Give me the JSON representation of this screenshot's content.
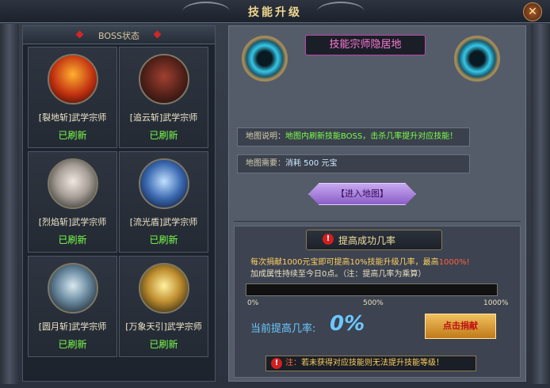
{
  "window": {
    "title": "技能升级",
    "close_glyph": "✕"
  },
  "boss_panel": {
    "header": "BOSS状态",
    "bosses": [
      {
        "name": "[裂地斩]武学宗师",
        "status": "已刷新"
      },
      {
        "name": "[追云斩]武学宗师",
        "status": "已刷新"
      },
      {
        "name": "[烈焰斩]武学宗师",
        "status": "已刷新"
      },
      {
        "name": "[流光盾]武学宗师",
        "status": "已刷新"
      },
      {
        "name": "[圆月斩]武学宗师",
        "status": "已刷新"
      },
      {
        "name": "[万象天引]武学宗师",
        "status": "已刷新"
      }
    ]
  },
  "map": {
    "title": "技能宗师隐居地",
    "desc_label": "地图说明：",
    "desc_value": "地图内刷新技能BOSS，击杀几率提升对应技能！",
    "need_label": "地图需要：",
    "need_value": "消耗 500 元宝",
    "enter_button": "【进入地图】"
  },
  "success": {
    "header": "提高成功几率",
    "warn_glyph": "!",
    "line1_a": "每次捐献1000元宝即可提高10%技能升级几率，最高",
    "line1_b": "1000%!",
    "line2": "加成属性持续至今日0点。（注：提高几率为乘算）",
    "progress": 0,
    "ticks": [
      "0%",
      "500%",
      "1000%"
    ],
    "current_label": "当前提高几率:",
    "current_value": "0%",
    "donate_button": "点击捐献",
    "note_label": "注：",
    "note_text": "若未获得对应技能则无法提升技能等级！"
  }
}
